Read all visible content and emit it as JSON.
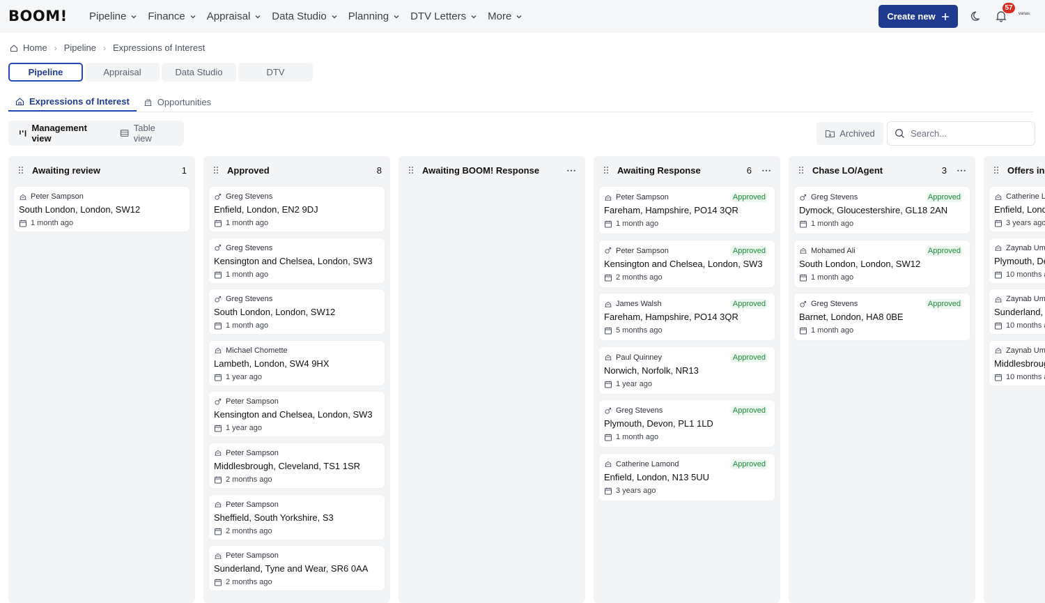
{
  "app": {
    "logo": "BOOM!"
  },
  "nav": {
    "items": [
      "Pipeline",
      "Finance",
      "Appraisal",
      "Data Studio",
      "Planning",
      "DTV Letters",
      "More"
    ],
    "create_label": "Create new",
    "notification_count": "57",
    "avatar_text": "vanas"
  },
  "breadcrumb": {
    "items": [
      "Home",
      "Pipeline",
      "Expressions of Interest"
    ]
  },
  "module_tabs": [
    "Pipeline",
    "Appraisal",
    "Data Studio",
    "DTV"
  ],
  "sub_tabs": [
    "Expressions of Interest",
    "Opportunities"
  ],
  "views": {
    "management": "Management view",
    "table": "Table view"
  },
  "toolbar": {
    "archived": "Archived",
    "search_placeholder": "Search..."
  },
  "columns": [
    {
      "title": "Awaiting review",
      "count": "1",
      "menu": false,
      "cards": [
        {
          "owner": "Peter Sampson",
          "owner_icon": "building",
          "address": "South London, London, SW12",
          "date": "1 month ago",
          "status": ""
        }
      ]
    },
    {
      "title": "Approved",
      "count": "8",
      "menu": false,
      "cards": [
        {
          "owner": "Greg Stevens",
          "owner_icon": "male",
          "address": "Enfield, London, EN2 9DJ",
          "date": "1 month ago",
          "status": ""
        },
        {
          "owner": "Greg Stevens",
          "owner_icon": "male",
          "address": "Kensington and Chelsea, London, SW3",
          "date": "1 month ago",
          "status": ""
        },
        {
          "owner": "Greg Stevens",
          "owner_icon": "male",
          "address": "South London, London, SW12",
          "date": "1 month ago",
          "status": ""
        },
        {
          "owner": "Michael Chomette",
          "owner_icon": "building",
          "address": "Lambeth, London, SW4 9HX",
          "date": "1 year ago",
          "status": ""
        },
        {
          "owner": "Peter Sampson",
          "owner_icon": "male",
          "address": "Kensington and Chelsea, London, SW3",
          "date": "1 year ago",
          "status": ""
        },
        {
          "owner": "Peter Sampson",
          "owner_icon": "building",
          "address": "Middlesbrough, Cleveland, TS1 1SR",
          "date": "2 months ago",
          "status": ""
        },
        {
          "owner": "Peter Sampson",
          "owner_icon": "building",
          "address": "Sheffield, South Yorkshire, S3",
          "date": "2 months ago",
          "status": ""
        },
        {
          "owner": "Peter Sampson",
          "owner_icon": "building",
          "address": "Sunderland, Tyne and Wear, SR6 0AA",
          "date": "2 months ago",
          "status": ""
        }
      ]
    },
    {
      "title": "Awaiting BOOM! Response",
      "count": "",
      "menu": true,
      "cards": []
    },
    {
      "title": "Awaiting Response",
      "count": "6",
      "menu": true,
      "cards": [
        {
          "owner": "Peter Sampson",
          "owner_icon": "building",
          "address": "Fareham, Hampshire, PO14 3QR",
          "date": "1 month ago",
          "status": "Approved"
        },
        {
          "owner": "Peter Sampson",
          "owner_icon": "male",
          "address": "Kensington and Chelsea, London, SW3",
          "date": "2 months ago",
          "status": "Approved"
        },
        {
          "owner": "James Walsh",
          "owner_icon": "building",
          "address": "Fareham, Hampshire, PO14 3QR",
          "date": "5 months ago",
          "status": "Approved"
        },
        {
          "owner": "Paul Quinney",
          "owner_icon": "building",
          "address": "Norwich, Norfolk, NR13",
          "date": "1 year ago",
          "status": "Approved"
        },
        {
          "owner": "Greg Stevens",
          "owner_icon": "male",
          "address": "Plymouth, Devon, PL1 1LD",
          "date": "1 month ago",
          "status": "Approved"
        },
        {
          "owner": "Catherine Lamond",
          "owner_icon": "building",
          "address": "Enfield, London, N13 5UU",
          "date": "3 years ago",
          "status": "Approved"
        }
      ]
    },
    {
      "title": "Chase LO/Agent",
      "count": "3",
      "menu": true,
      "cards": [
        {
          "owner": "Greg Stevens",
          "owner_icon": "male",
          "address": "Dymock, Gloucestershire, GL18 2AN",
          "date": "1 month ago",
          "status": "Approved"
        },
        {
          "owner": "Mohamed Ali",
          "owner_icon": "building",
          "address": "South London, London, SW12",
          "date": "1 month ago",
          "status": "Approved"
        },
        {
          "owner": "Greg Stevens",
          "owner_icon": "male",
          "address": "Barnet, London, HA8 0BE",
          "date": "1 month ago",
          "status": "Approved"
        }
      ]
    },
    {
      "title": "Offers in",
      "count": "",
      "menu": false,
      "cards": [
        {
          "owner": "Catherine L",
          "owner_icon": "building",
          "address": "Enfield, Lond",
          "date": "3 years ago",
          "status": ""
        },
        {
          "owner": "Zaynab Um",
          "owner_icon": "building",
          "address": "Plymouth, De",
          "date": "10 months a",
          "status": ""
        },
        {
          "owner": "Zaynab Um",
          "owner_icon": "building",
          "address": "Sunderland, T",
          "date": "10 months a",
          "status": ""
        },
        {
          "owner": "Zaynab Um",
          "owner_icon": "building",
          "address": "Middlesbroug",
          "date": "10 months a",
          "status": ""
        }
      ]
    }
  ],
  "colors": {
    "primary": "#1f3a8f",
    "accent_border": "#2448b8",
    "status_green": "#1f8b3a",
    "badge_red": "#d92d20",
    "column_bg": "#f3f4f6"
  },
  "icons": {
    "building": "building-icon",
    "male": "male-icon",
    "calendar": "calendar-icon",
    "grip": "drag-handle-icon"
  }
}
